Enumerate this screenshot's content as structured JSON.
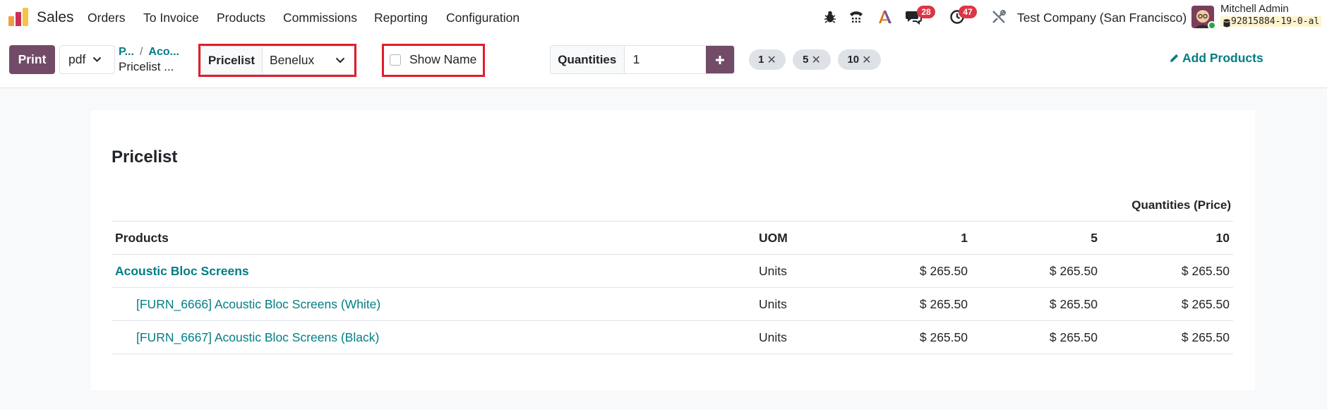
{
  "navbar": {
    "app_name": "Sales",
    "menu": [
      "Orders",
      "To Invoice",
      "Products",
      "Commissions",
      "Reporting",
      "Configuration"
    ],
    "icons": [
      "bug-icon",
      "phone-icon",
      "ai-icon",
      "chat-icon",
      "clock-icon",
      "tools-icon"
    ],
    "messages_badge": "28",
    "activities_badge": "47",
    "company": "Test Company (San Francisco)",
    "user_name": "Mitchell Admin",
    "database": "92815884-19-0-al"
  },
  "control": {
    "print_label": "Print",
    "format_value": "pdf",
    "breadcrumb": [
      "P...",
      "Aco..."
    ],
    "breadcrumb_current": "Pricelist ...",
    "pricelist_label": "Pricelist",
    "pricelist_value": "Benelux",
    "show_name_label": "Show Name",
    "show_name_checked": false,
    "quantities_label": "Quantities",
    "quantities_value": "1",
    "quantity_chips": [
      "1",
      "5",
      "10"
    ],
    "add_products_label": "Add Products"
  },
  "report": {
    "title": "Pricelist",
    "group_header": "Quantities (Price)",
    "columns": [
      "Products",
      "UOM",
      "1",
      "5",
      "10"
    ],
    "rows": [
      {
        "product": "Acoustic Bloc Screens",
        "uom": "Units",
        "p1": "$ 265.50",
        "p5": "$ 265.50",
        "p10": "$ 265.50"
      },
      {
        "product": "[FURN_6666] Acoustic Bloc Screens (White)",
        "uom": "Units",
        "p1": "$ 265.50",
        "p5": "$ 265.50",
        "p10": "$ 265.50"
      },
      {
        "product": "[FURN_6667] Acoustic Bloc Screens (Black)",
        "uom": "Units",
        "p1": "$ 265.50",
        "p5": "$ 265.50",
        "p10": "$ 265.50"
      }
    ]
  },
  "colors": {
    "brand": "#714b67",
    "link": "#017e84",
    "highlight_box": "#e11d2b",
    "badge": "#dc3545"
  }
}
